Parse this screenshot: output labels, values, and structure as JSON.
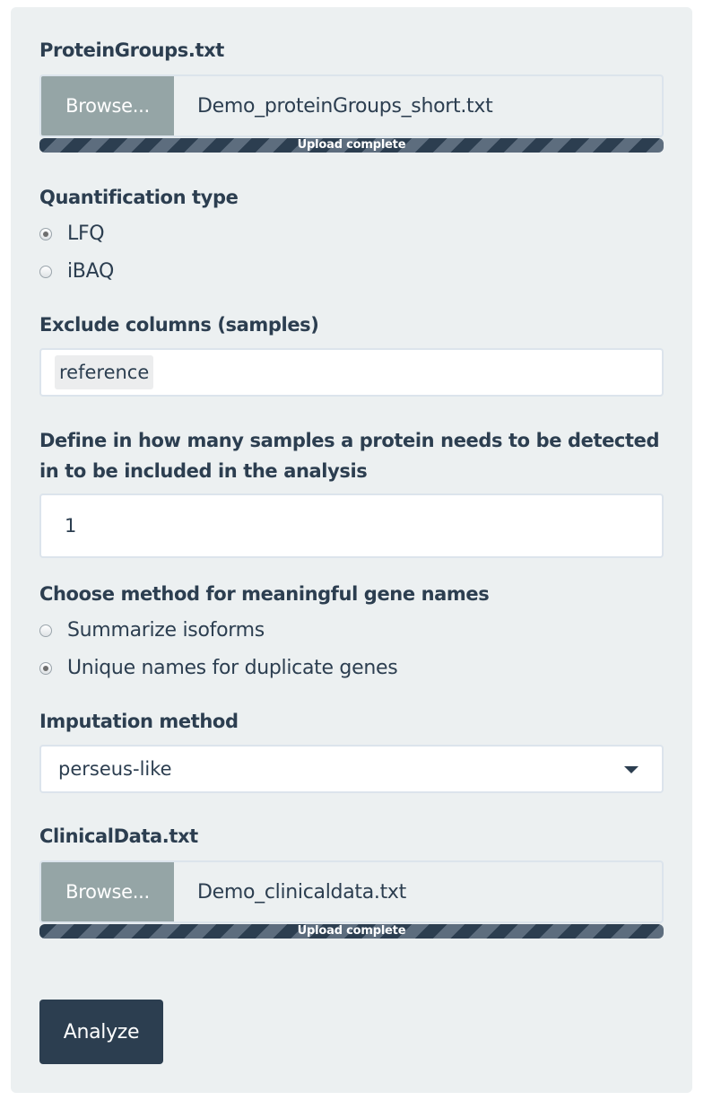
{
  "protein_file": {
    "label": "ProteinGroups.txt",
    "browse_label": "Browse...",
    "filename": "Demo_proteinGroups_short.txt",
    "progress_text": "Upload complete",
    "progress": 1.0
  },
  "quant_type": {
    "label": "Quantification type",
    "options": [
      {
        "label": "LFQ",
        "selected": true
      },
      {
        "label": "iBAQ",
        "selected": false
      }
    ]
  },
  "exclude": {
    "label": "Exclude columns (samples)",
    "chips": [
      "reference"
    ]
  },
  "min_samples": {
    "label": "Define in how many samples a protein needs to be detected in to be included in the analysis",
    "value": "1"
  },
  "gene_names": {
    "label": "Choose method for meaningful gene names",
    "options": [
      {
        "label": "Summarize isoforms",
        "selected": false
      },
      {
        "label": "Unique names for duplicate genes",
        "selected": true
      }
    ]
  },
  "imputation": {
    "label": "Imputation method",
    "value": "perseus-like"
  },
  "clinical_file": {
    "label": "ClinicalData.txt",
    "browse_label": "Browse...",
    "filename": "Demo_clinicaldata.txt",
    "progress_text": "Upload complete",
    "progress": 1.0
  },
  "analyze_label": "Analyze",
  "colors": {
    "panel_bg": "#ecf0f1",
    "primary": "#2c3e50",
    "browse_bg": "#95a5a6",
    "border": "#dce4ec"
  }
}
